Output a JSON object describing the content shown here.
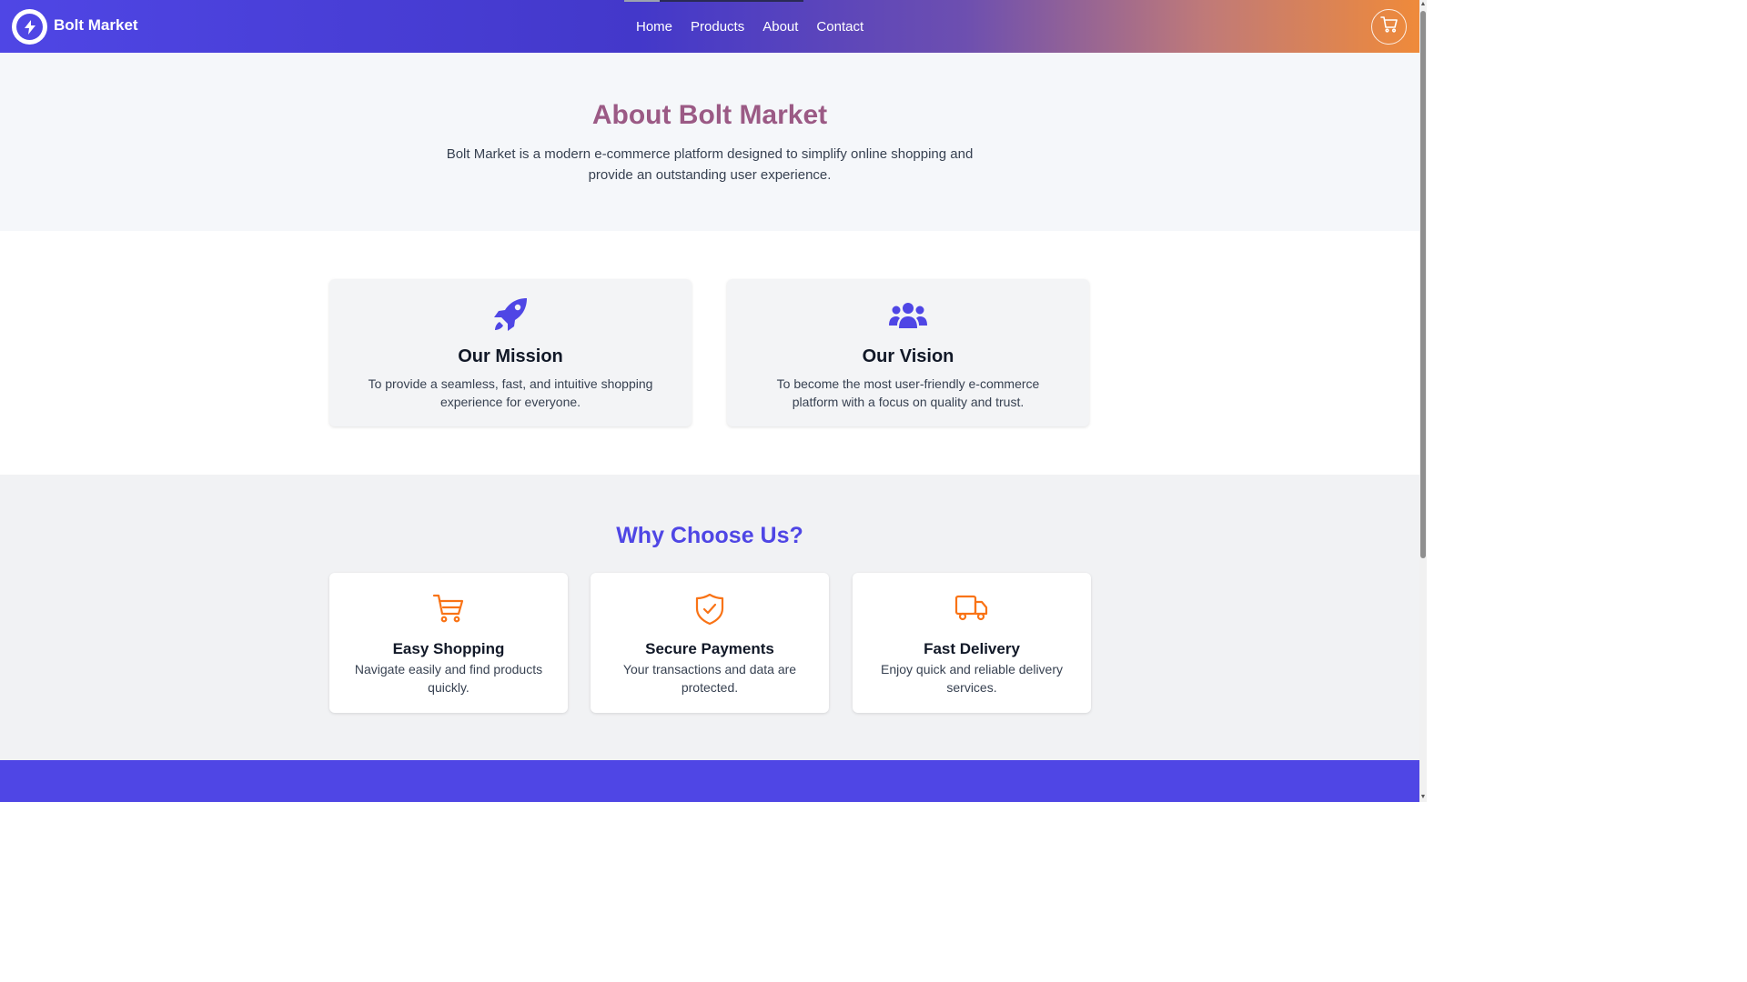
{
  "header": {
    "brand": "Bolt Market",
    "nav": [
      "Home",
      "Products",
      "About",
      "Contact"
    ],
    "icons": {
      "logo": "lightning-bolt-icon",
      "cart": "shopping-cart-icon"
    }
  },
  "hero": {
    "title": "About Bolt Market",
    "description": "Bolt Market is a modern e-commerce platform designed to simplify online shopping and provide an outstanding user experience."
  },
  "mission": {
    "title": "Our Mission",
    "text": "To provide a seamless, fast, and intuitive shopping experience for everyone.",
    "icon": "rocket-icon"
  },
  "vision": {
    "title": "Our Vision",
    "text": "To become the most user-friendly e-commerce platform with a focus on quality and trust.",
    "icon": "users-icon"
  },
  "why": {
    "title": "Why Choose Us?",
    "features": [
      {
        "title": "Easy Shopping",
        "text": "Navigate easily and find products quickly.",
        "icon": "shopping-cart-icon"
      },
      {
        "title": "Secure Payments",
        "text": "Your transactions and data are protected.",
        "icon": "shield-check-icon"
      },
      {
        "title": "Fast Delivery",
        "text": "Enjoy quick and reliable delivery services.",
        "icon": "truck-icon"
      }
    ]
  },
  "colors": {
    "primary": "#4f46e5",
    "accent": "#f97316",
    "hero_title": "#9b5a85"
  }
}
